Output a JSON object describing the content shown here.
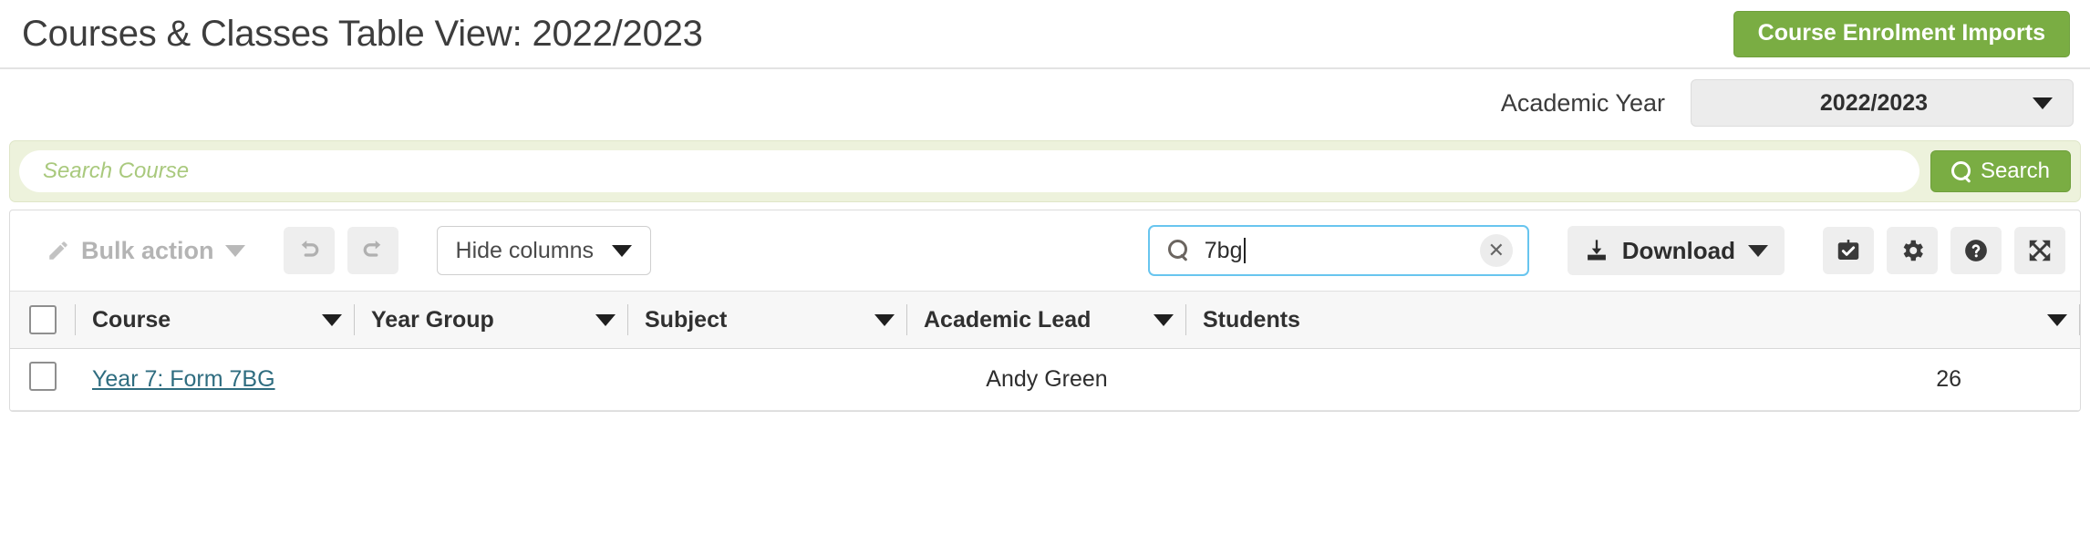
{
  "header": {
    "title": "Courses & Classes Table View: 2022/2023",
    "primary_button": "Course Enrolment Imports"
  },
  "filters": {
    "academic_year_label": "Academic Year",
    "academic_year_value": "2022/2023"
  },
  "course_search": {
    "placeholder": "Search Course",
    "value": "",
    "button_label": "Search"
  },
  "toolbar": {
    "bulk_action_label": "Bulk action",
    "hide_columns_label": "Hide columns",
    "grid_search_value": "7bg",
    "download_label": "Download",
    "icons": {
      "undo": "undo-icon",
      "redo": "redo-icon",
      "select": "checkbox-check-icon",
      "settings": "gear-icon",
      "help": "question-mark-icon",
      "fullscreen": "expand-arrows-icon",
      "pencil": "pencil-icon",
      "search": "search-icon",
      "clear": "clear-x-icon",
      "download": "download-tray-icon"
    }
  },
  "table": {
    "columns": [
      {
        "label": "Course"
      },
      {
        "label": "Year Group"
      },
      {
        "label": "Subject"
      },
      {
        "label": "Academic Lead"
      },
      {
        "label": "Students"
      }
    ],
    "rows": [
      {
        "course": "Year 7: Form 7BG",
        "year_group": "",
        "subject": "",
        "academic_lead": "Andy Green",
        "students": "26"
      }
    ]
  },
  "colors": {
    "brand_green": "#7aad43",
    "panel_green": "#edf2dc",
    "focus_blue": "#68c5ef",
    "link_teal": "#2f6d80"
  }
}
